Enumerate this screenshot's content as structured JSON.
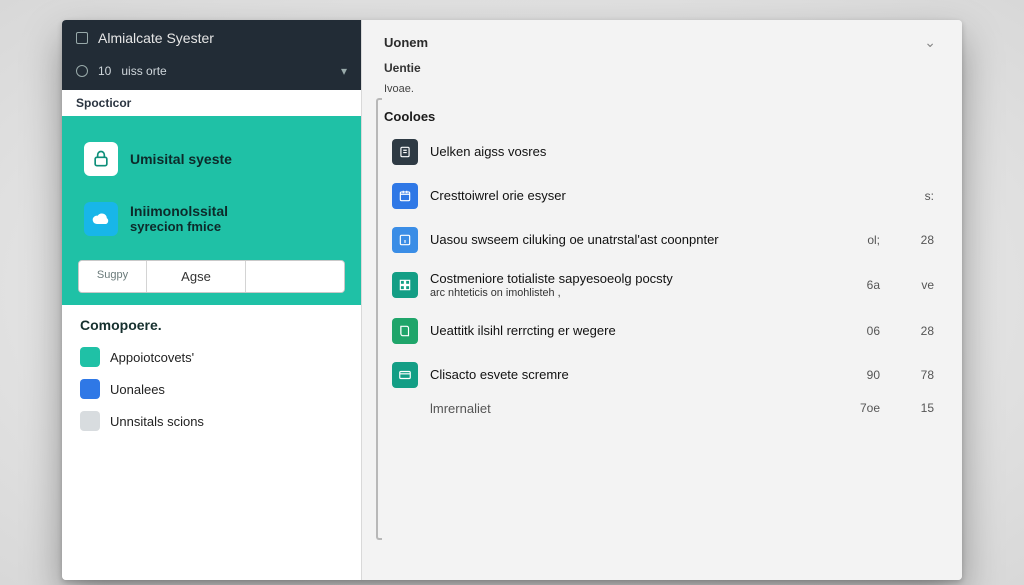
{
  "titlebar": {
    "title": "Almialcate Syester"
  },
  "filter": {
    "count": "10",
    "label": "uiss orte"
  },
  "sidebar": {
    "section_label": "Spocticor",
    "nav": [
      {
        "label": "Umisital syeste"
      },
      {
        "label_line1": "Iniimonolssital",
        "label_line2": "syrecion fmice"
      }
    ],
    "segments": {
      "a": "Sugpy",
      "b": "Agse",
      "c": ""
    },
    "category_title": "Comopoere.",
    "categories": [
      {
        "label": "Appoiotcovets'",
        "swatch": "teal"
      },
      {
        "label": "Uonalees",
        "swatch": "blue"
      },
      {
        "label": "Unnsitals scions",
        "swatch": "gray"
      }
    ]
  },
  "main": {
    "breadcrumb": "Uonem",
    "line1": "Uentie",
    "line2": "Ivoae.",
    "group_title": "Cooloes",
    "rows": [
      {
        "icon": "dark",
        "iconName": "note-icon",
        "text": "Uelken aigss vosres",
        "meta": []
      },
      {
        "icon": "blue",
        "iconName": "calendar-icon",
        "text": "Cresttoiwrel orie esyser",
        "meta": [
          "s:"
        ]
      },
      {
        "icon": "bluel",
        "iconName": "info-icon",
        "text": "Uasou swseem ciluking oe unatrstal'ast coonpnter",
        "meta": [
          "ol;",
          "28"
        ]
      },
      {
        "icon": "teal",
        "iconName": "grid-icon",
        "text": "Costmeniore totialiste sapyesoeolg pocsty",
        "sub": "arc nhteticis on imohlisteh ,",
        "meta": [
          "6a",
          "ve"
        ]
      },
      {
        "icon": "green",
        "iconName": "book-icon",
        "text": "Ueattitk ilsihl rerrcting er wegere",
        "meta": [
          "06",
          "28"
        ]
      },
      {
        "icon": "teal",
        "iconName": "card-icon",
        "text": "Clisacto esvete scremre",
        "meta": [
          "90",
          "78"
        ]
      }
    ],
    "footer": {
      "text": "lmrernaliet",
      "meta": [
        "7oe",
        "15"
      ]
    }
  }
}
